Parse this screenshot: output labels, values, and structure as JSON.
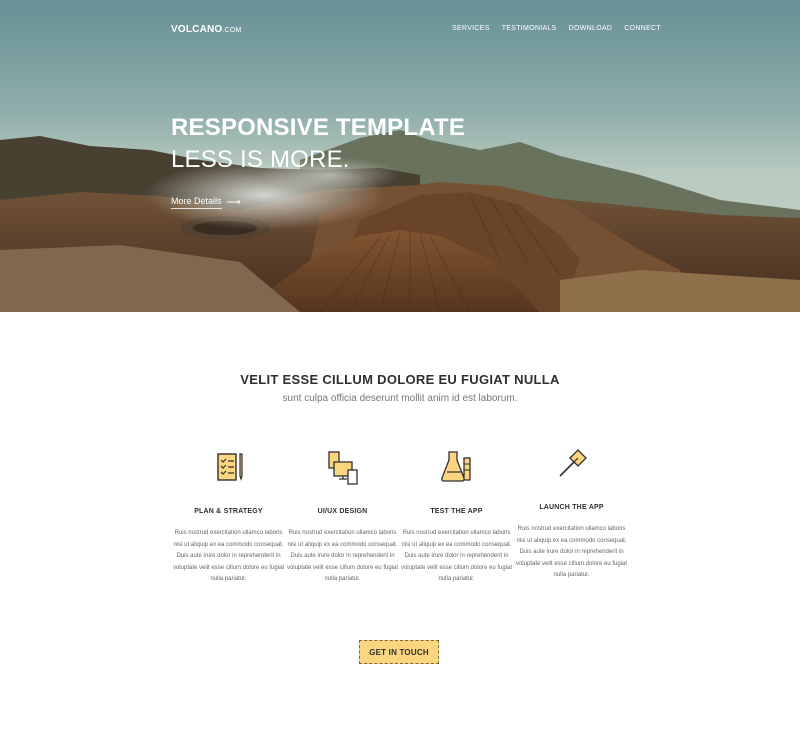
{
  "header": {
    "logo_main": "VOLCANO",
    "logo_suffix": ".COM",
    "nav": [
      "SERVICES",
      "TESTIMONIALS",
      "DOWNLOAD",
      "CONNECT"
    ]
  },
  "hero": {
    "title": "RESPONSIVE TEMPLATE",
    "subtitle": "LESS IS MORE.",
    "link_label": "More Details",
    "link_arrow": "⟶"
  },
  "section": {
    "title": "VELIT ESSE CILLUM DOLORE EU FUGIAT NULLA",
    "subtitle": "sunt culpa officia deserunt mollit anim id est laborum."
  },
  "features": [
    {
      "icon": "checklist-pencil-icon",
      "title": "PLAN & STRATEGY",
      "text": "Ruis nostrud exercitation ullamco laboris nisi ut aliquip ex ea commodo consequat. Duis aute irure dolor in reprehenderit in voluptate velit esse cillum dolore eu fugiat nulla pariatur."
    },
    {
      "icon": "devices-icon",
      "title": "UI/UX DESIGN",
      "text": "Ruis nostrud exercitation ullamco laboris nisi ut aliquip ex ea commodo consequat. Duis aute irure dolor in reprehenderit in voluptate velit esse cillum dolore eu fugiat nulla pariatur."
    },
    {
      "icon": "lab-flask-icon",
      "title": "TEST THE APP",
      "text": "Ruis nostrud exercitation ullamco laboris nisi ut aliquip ex ea commodo consequat. Duis aute irure dolor in reprehenderit in voluptate velit esse cillum dolore eu fugiat nulla pariatur."
    },
    {
      "icon": "flag-icon",
      "title": "LAUNCH THE APP",
      "text": "Ruis nostrud exercitation ullamco laboris nisi ut aliquip ex ea commodo consequat. Duis aute irure dolor in reprehenderit in voluptate velit esse cillum dolore eu fugiat nulla pariatur."
    }
  ],
  "cta": {
    "label": "GET IN TOUCH"
  },
  "colors": {
    "accent": "#fbd681",
    "text_dark": "#2f2f2f",
    "text_muted": "#777777"
  }
}
